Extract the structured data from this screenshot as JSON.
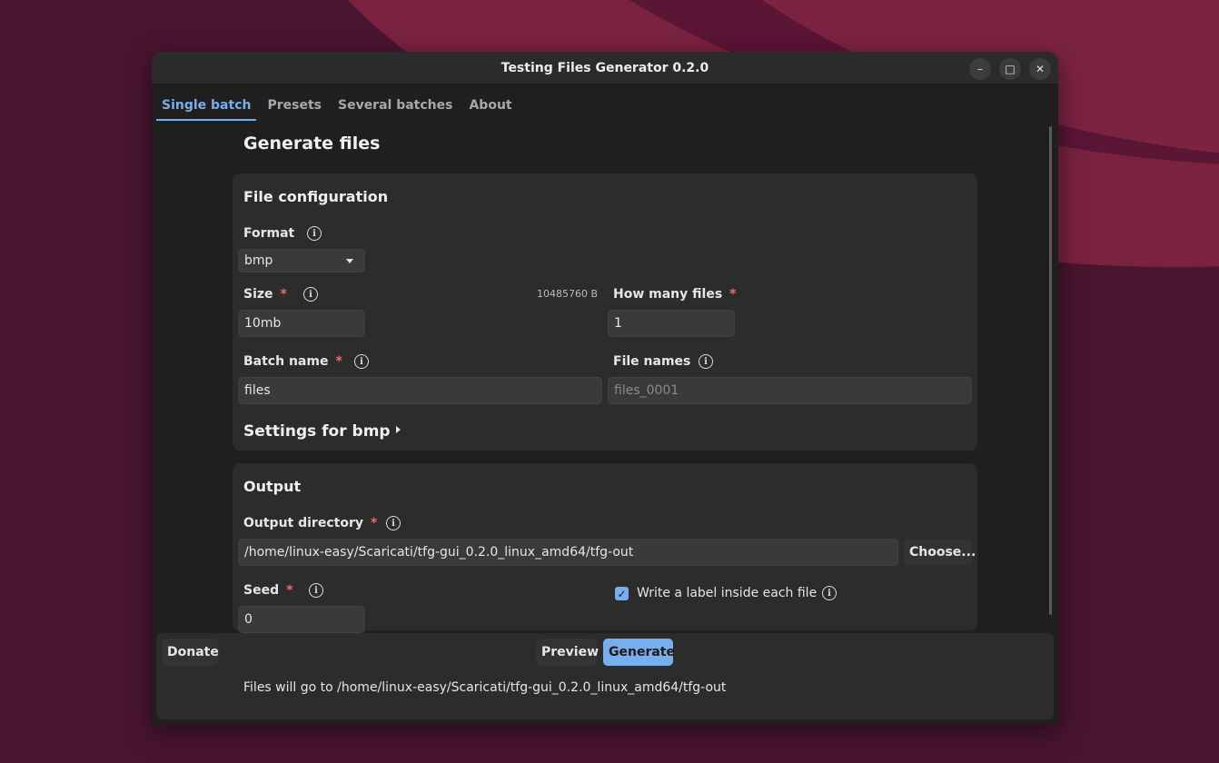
{
  "window": {
    "title": "Testing Files Generator 0.2.0"
  },
  "window_controls": {
    "minimize": "–",
    "maximize": "□",
    "close": "✕"
  },
  "tabs": [
    {
      "label": "Single batch",
      "active": true
    },
    {
      "label": "Presets",
      "active": false
    },
    {
      "label": "Several batches",
      "active": false
    },
    {
      "label": "About",
      "active": false
    }
  ],
  "page": {
    "title": "Generate files"
  },
  "file_config": {
    "title": "File configuration",
    "format": {
      "label": "Format",
      "value": "bmp"
    },
    "size": {
      "label": "Size",
      "required": "*",
      "value": "10mb",
      "bytes": "10485760 B"
    },
    "how_many": {
      "label": "How many files",
      "required": "*",
      "value": "1"
    },
    "batch_name": {
      "label": "Batch name",
      "required": "*",
      "value": "files"
    },
    "file_names": {
      "label": "File names",
      "placeholder": "files_0001"
    },
    "settings_expander": "Settings for bmp"
  },
  "output": {
    "title": "Output",
    "directory": {
      "label": "Output directory",
      "required": "*",
      "value": "/home/linux-easy/Scaricati/tfg-gui_0.2.0_linux_amd64/tfg-out"
    },
    "choose_label": "Choose...",
    "seed": {
      "label": "Seed",
      "required": "*",
      "value": "0"
    },
    "write_label": {
      "label": "Write a label inside each file",
      "checked": true
    }
  },
  "footer": {
    "donate_label": "Donate",
    "preview_label": "Preview",
    "generate_label": "Generate",
    "status": "Files will go to /home/linux-easy/Scaricati/tfg-gui_0.2.0_linux_amd64/tfg-out"
  },
  "icons": {
    "info": "i",
    "check": "✓"
  },
  "colors": {
    "accent": "#78aeed",
    "required": "#ee6e6e",
    "window_bg": "#1f1f1f",
    "card_bg": "#2c2c2c"
  }
}
